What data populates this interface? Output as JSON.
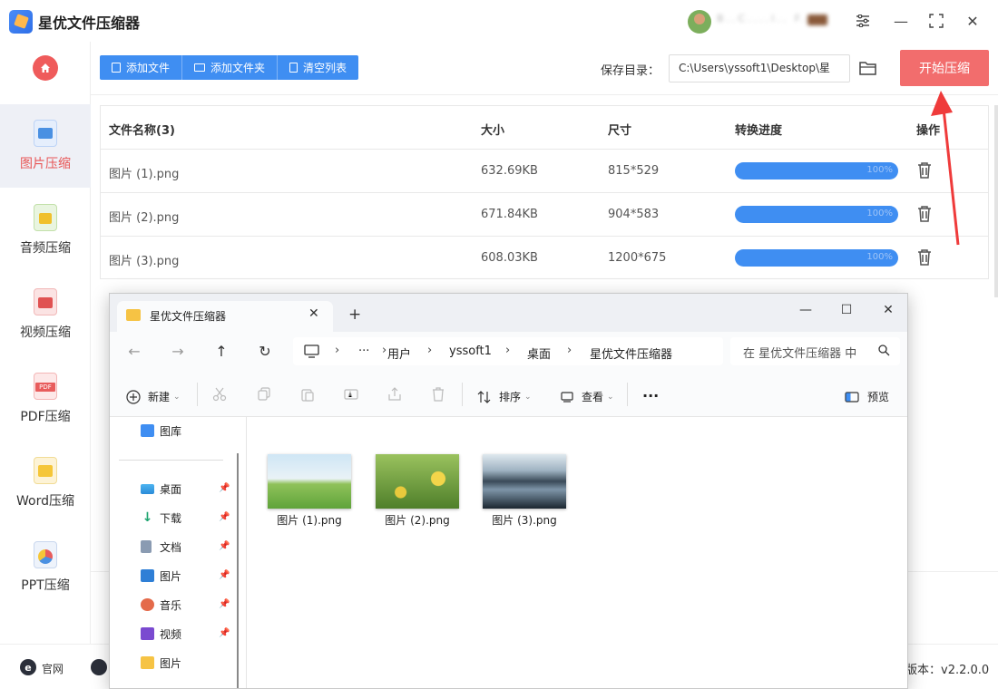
{
  "app": {
    "title": "星优文件压缩器",
    "user_name": "B..C....l.. F.....",
    "window_controls": {
      "settings": "☰",
      "minimize": "—",
      "maximize": "⛶",
      "close": "✕"
    }
  },
  "sidebar": {
    "items": [
      {
        "label": "图片压缩",
        "icon": "image-icon",
        "active": true
      },
      {
        "label": "音频压缩",
        "icon": "audio-icon",
        "active": false
      },
      {
        "label": "视频压缩",
        "icon": "video-icon",
        "active": false
      },
      {
        "label": "PDF压缩",
        "icon": "pdf-icon",
        "active": false
      },
      {
        "label": "Word压缩",
        "icon": "word-icon",
        "active": false
      },
      {
        "label": "PPT压缩",
        "icon": "ppt-icon",
        "active": false
      }
    ],
    "pdf_badge": "PDF"
  },
  "toolbar": {
    "add_file": "添加文件",
    "add_folder": "添加文件夹",
    "clear_list": "清空列表",
    "save_dir_label": "保存目录：",
    "save_dir_value": "C:\\Users\\yssoft1\\Desktop\\星",
    "start_button": "开始压缩"
  },
  "table": {
    "headers": {
      "name": "文件名称(3)",
      "size": "大小",
      "dimensions": "尺寸",
      "progress": "转换进度",
      "action": "操作"
    },
    "rows": [
      {
        "name": "图片 (1).png",
        "size": "632.69KB",
        "dimensions": "815*529",
        "progress": "100%"
      },
      {
        "name": "图片 (2).png",
        "size": "671.84KB",
        "dimensions": "904*583",
        "progress": "100%"
      },
      {
        "name": "图片 (3).png",
        "size": "608.03KB",
        "dimensions": "1200*675",
        "progress": "100%"
      }
    ]
  },
  "footer": {
    "site_icon": "e",
    "site_label": "官网",
    "version": "版本：v2.2.0.0"
  },
  "explorer": {
    "tab_title": "星优文件压缩器",
    "tab_close": "✕",
    "new_tab": "+",
    "window_controls": {
      "minimize": "—",
      "maximize": "☐",
      "close": "✕"
    },
    "nav": {
      "back": "←",
      "forward": "→",
      "up": "↑",
      "refresh": "↻"
    },
    "breadcrumb": {
      "more": "···",
      "items": [
        "用户",
        "yssoft1",
        "桌面",
        "星优文件压缩器"
      ],
      "separator": "›"
    },
    "search_placeholder": "在 星优文件压缩器 中",
    "commands": {
      "new": "新建",
      "sort": "排序",
      "view": "查看",
      "more": "···",
      "preview": "预览"
    },
    "nav_pane": {
      "top": [
        {
          "label": "图库",
          "icon": "gallery-icon"
        }
      ],
      "quick": [
        {
          "label": "桌面",
          "icon": "desktop-icon"
        },
        {
          "label": "下载",
          "icon": "download-icon"
        },
        {
          "label": "文档",
          "icon": "documents-icon"
        },
        {
          "label": "图片",
          "icon": "pictures-icon"
        },
        {
          "label": "音乐",
          "icon": "music-icon"
        },
        {
          "label": "视频",
          "icon": "videos-icon"
        },
        {
          "label": "图片",
          "icon": "folder-icon"
        }
      ]
    },
    "files": [
      {
        "label": "图片 (1).png",
        "icon": "landscape-thumbnail"
      },
      {
        "label": "图片 (2).png",
        "icon": "flowers-thumbnail"
      },
      {
        "label": "图片 (3).png",
        "icon": "lake-thumbnail"
      }
    ]
  },
  "colors": {
    "accent_blue": "#3f8ef2",
    "start_red": "#f26d6d",
    "active_nav": "#e85555",
    "arrow_red": "#ef3b3b"
  }
}
